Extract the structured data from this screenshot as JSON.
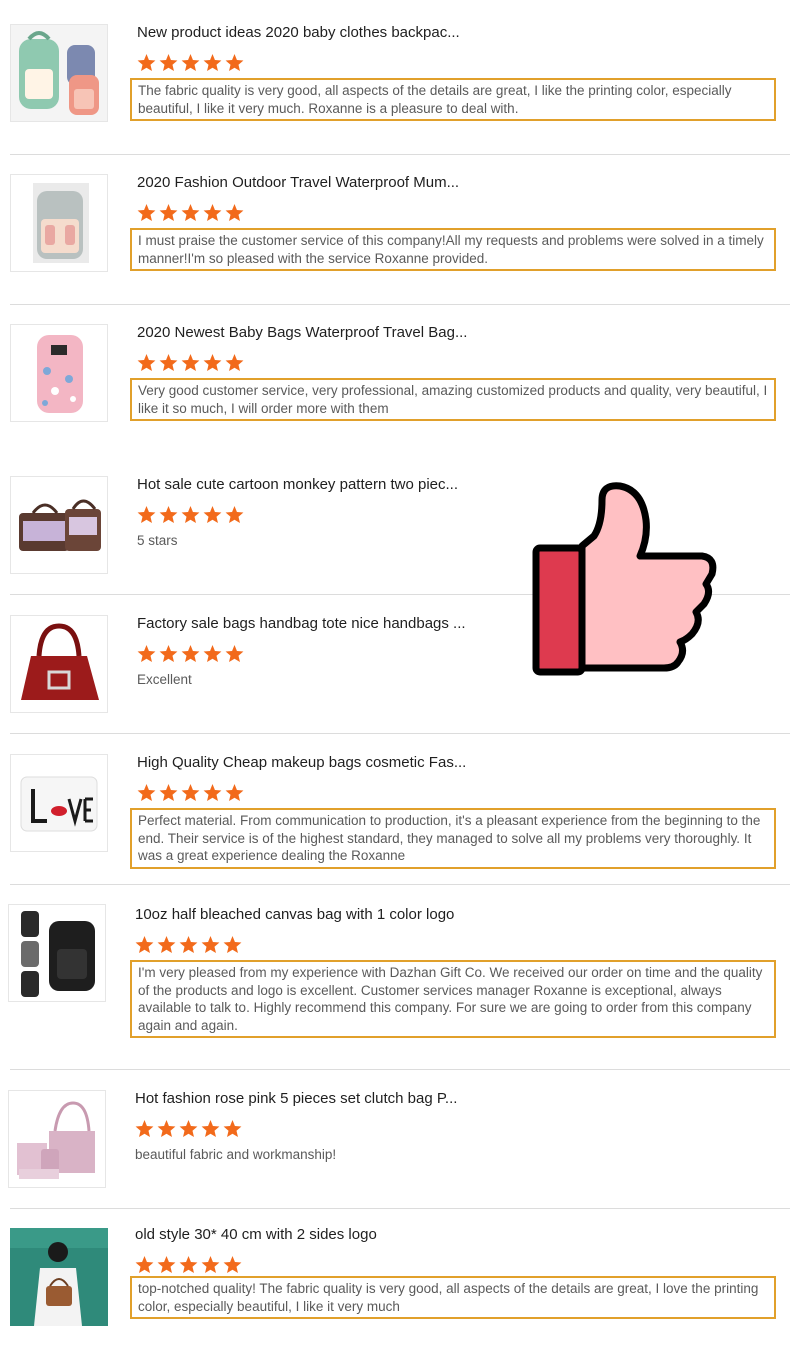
{
  "reviews": [
    {
      "title": "New product ideas 2020 baby clothes backpac...",
      "rating": 5,
      "comment": "The fabric quality is very good, all aspects of the details are great, I like the printing color, especially beautiful, I like it very much. Roxanne is a pleasure to deal with.",
      "highlighted": true,
      "image": "mint-and-pink-diaper-backpacks"
    },
    {
      "title": "2020 Fashion Outdoor Travel Waterproof Mum...",
      "rating": 5,
      "comment": "I must praise the customer service of this company!All my requests and problems were solved in a timely manner!I'm so pleased with the service Roxanne provided.",
      "highlighted": true,
      "image": "grey-diaper-backpack"
    },
    {
      "title": "2020 Newest Baby Bags Waterproof Travel Bag...",
      "rating": 5,
      "comment": "Very good customer service, very professional, amazing customized products and quality, very beautiful, I like it so much, I will order more with them",
      "highlighted": true,
      "image": "pink-printed-diaper-backpack"
    },
    {
      "title": "Hot sale cute cartoon monkey pattern two piec...",
      "rating": 5,
      "comment": "5 stars",
      "highlighted": false,
      "image": "brown-monkey-pattern-bag-set"
    },
    {
      "title": "Factory sale bags handbag tote nice handbags ...",
      "rating": 5,
      "comment": "Excellent",
      "highlighted": false,
      "image": "red-leather-handbag"
    },
    {
      "title": "High Quality Cheap makeup bags cosmetic Fas...",
      "rating": 5,
      "comment": "Perfect material. From communication to production, it's a pleasant experience from the beginning to the end. Their service is of the highest standard, they managed to solve all my problems very thoroughly. It was a great experience dealing the Roxanne",
      "highlighted": true,
      "image": "love-print-cosmetic-bag"
    },
    {
      "title": "10oz half bleached canvas bag with 1 color logo",
      "rating": 5,
      "comment": "I'm very pleased from my experience with Dazhan Gift Co. We received our order on time and the quality of the products and logo is excellent. Customer services manager Roxanne is exceptional, always available to talk to. Highly recommend this company. For sure we are going to order from this company again and again.",
      "highlighted": true,
      "image": "black-laptop-backpacks"
    },
    {
      "title": "Hot fashion rose pink 5 pieces set clutch bag P...",
      "rating": 5,
      "comment": "beautiful fabric and workmanship!",
      "highlighted": false,
      "image": "rose-pink-five-piece-bag-set"
    },
    {
      "title": "old style 30* 40 cm with 2 sides logo",
      "rating": 5,
      "comment": "top-notched quality! The fabric quality is very good, all aspects of the details are great, I love the printing color, especially beautiful, I like it very much",
      "highlighted": true,
      "image": "woman-with-brown-shoulder-bag"
    }
  ],
  "colors": {
    "star": "#f26a1b",
    "highlight_border": "#e1a02b",
    "thumb_cuff": "#de3a4f",
    "thumb_body": "#ffc0c3"
  }
}
